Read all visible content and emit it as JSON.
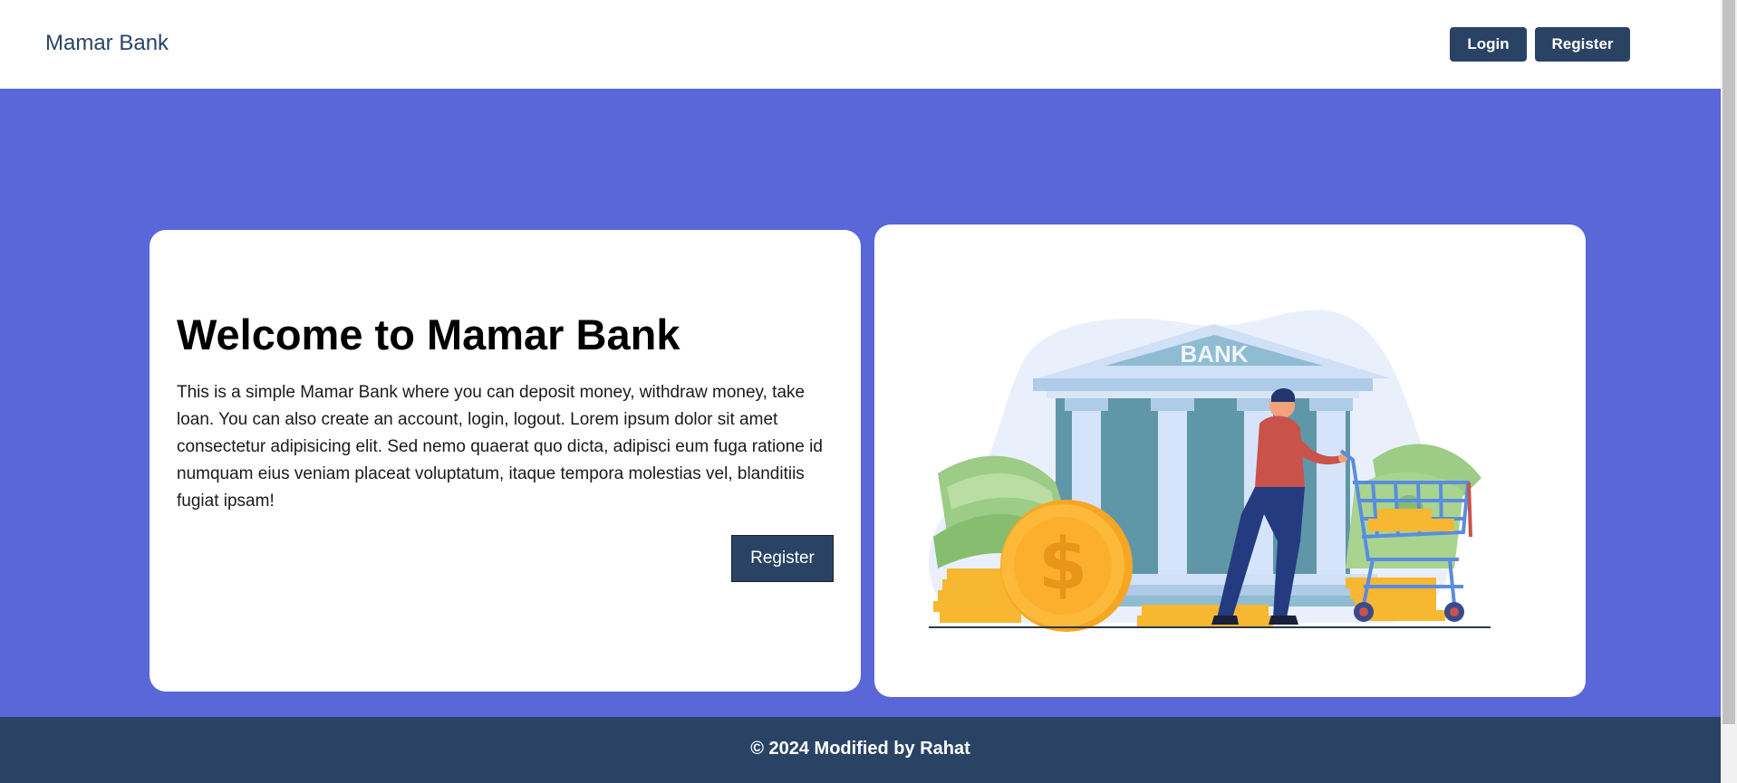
{
  "navbar": {
    "brand": "Mamar Bank",
    "login_label": "Login",
    "register_label": "Register"
  },
  "hero": {
    "title": "Welcome to Mamar Bank",
    "description": "This is a simple Mamar Bank where you can deposit money, withdraw money, take loan. You can also create an account, login, logout. Lorem ipsum dolor sit amet consectetur adipisicing elit. Sed nemo quaerat quo dicta, adipisci eum fuga ratione id numquam eius veniam placeat voluptatum, itaque tempora molestias vel, blanditiis fugiat ipsam!",
    "register_label": "Register",
    "illustration": {
      "bank_sign": "BANK",
      "coin_symbol": "$"
    }
  },
  "footer": {
    "text": "© 2024 Modified by Rahat"
  },
  "colors": {
    "primary": "#2a4365",
    "hero_bg": "#5a67d8",
    "card_bg": "#ffffff"
  }
}
